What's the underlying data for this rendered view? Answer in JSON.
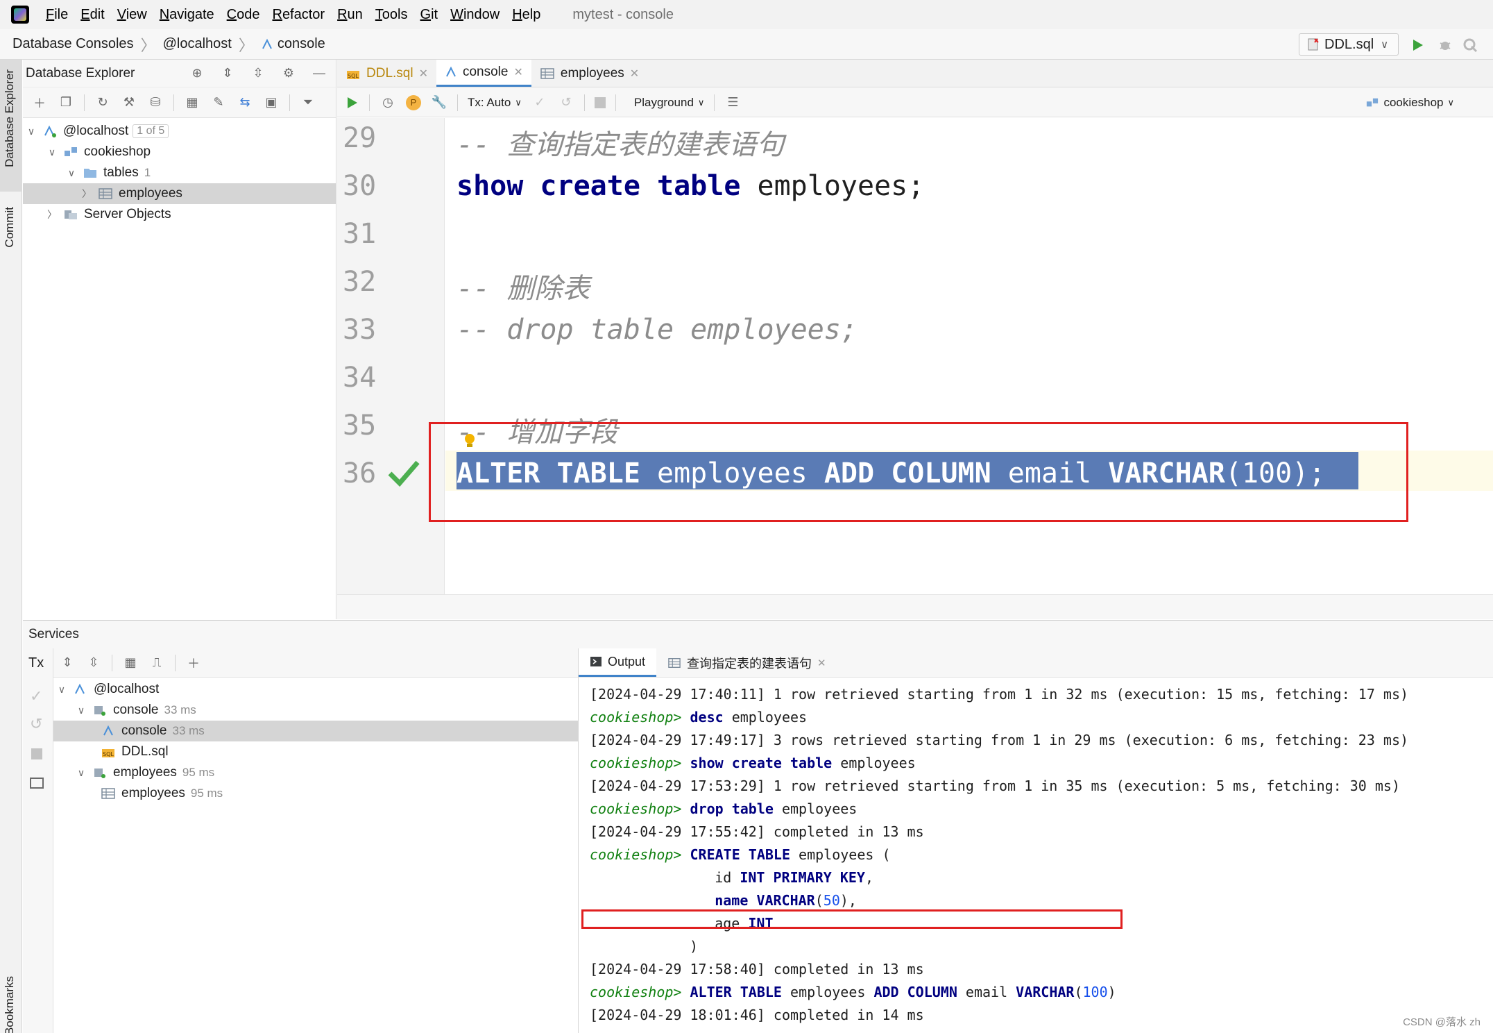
{
  "window_title": "mytest - console",
  "menu": [
    {
      "u": "F",
      "rest": "ile"
    },
    {
      "u": "E",
      "rest": "dit"
    },
    {
      "u": "V",
      "rest": "iew"
    },
    {
      "u": "N",
      "rest": "avigate"
    },
    {
      "u": "C",
      "rest": "ode"
    },
    {
      "u": "R",
      "rest": "efactor"
    },
    {
      "u": "R",
      "rest": "un"
    },
    {
      "u": "T",
      "rest": "ools"
    },
    {
      "u": "G",
      "rest": "it"
    },
    {
      "u": "W",
      "rest": "indow"
    },
    {
      "u": "H",
      "rest": "elp"
    }
  ],
  "breadcrumb": [
    "Database Consoles",
    "@localhost",
    "console"
  ],
  "run_config": "DDL.sql",
  "left_strip": {
    "database_explorer": "Database Explorer",
    "commit": "Commit",
    "bookmarks": "Bookmarks"
  },
  "db_explorer": {
    "title": "Database Explorer",
    "tree": [
      {
        "label": "@localhost",
        "badge": "1 of 5"
      },
      {
        "label": "cookieshop"
      },
      {
        "label": "tables",
        "count": "1"
      },
      {
        "label": "employees"
      },
      {
        "label": "Server Objects"
      }
    ]
  },
  "editor_tabs": [
    {
      "label": "DDL.sql",
      "icon": "sql-file-icon"
    },
    {
      "label": "console",
      "icon": "console-icon"
    },
    {
      "label": "employees",
      "icon": "table-icon"
    }
  ],
  "editor_toolbar": {
    "tx_mode": "Tx: Auto",
    "playground": "Playground",
    "schema": "cookieshop",
    "p_badge": "P"
  },
  "editor": {
    "line_numbers": [
      "29",
      "30",
      "31",
      "32",
      "33",
      "34",
      "35",
      "36"
    ],
    "line29_comment": "-- 查询指定表的建表语句",
    "line30": {
      "kw1": "show",
      "kw2": "create",
      "kw3": "table",
      "rest": " employees;"
    },
    "line32_comment": "-- 删除表",
    "line33_comment": "-- drop table employees;",
    "line35_comment": "-- 增加字段",
    "line36": {
      "kw1": "ALTER",
      "kw2": "TABLE",
      "t1": " employees ",
      "kw3": "ADD",
      "kw4": "COLUMN",
      "t2": " email ",
      "kw5": "VARCHAR",
      "paren_open": "(",
      "num": "100",
      "paren_close": ")",
      "semicolon": ";"
    }
  },
  "services": {
    "title": "Services",
    "tx_label": "Tx",
    "tree": [
      {
        "label": "@localhost"
      },
      {
        "label": "console",
        "time": "33 ms"
      },
      {
        "label": "console",
        "time": "33 ms"
      },
      {
        "label": "DDL.sql"
      },
      {
        "label": "employees",
        "time": "95 ms"
      },
      {
        "label": "employees",
        "time": "95 ms"
      }
    ],
    "output_tabs": [
      {
        "label": "Output"
      },
      {
        "label": "查询指定表的建表语句"
      }
    ],
    "prompt": "cookieshop>",
    "output": {
      "l1": "[2024-04-29 17:40:11] 1 row retrieved starting from 1 in 32 ms (execution: 15 ms, fetching: 17 ms)",
      "l2_kw": "desc",
      "l2_rest": " employees",
      "l3": "[2024-04-29 17:49:17] 3 rows retrieved starting from 1 in 29 ms (execution: 6 ms, fetching: 23 ms)",
      "l4_kw1": "show",
      "l4_kw2": "create",
      "l4_kw3": "table",
      "l4_rest": " employees",
      "l5": "[2024-04-29 17:53:29] 1 row retrieved starting from 1 in 35 ms (execution: 5 ms, fetching: 30 ms)",
      "l6_kw1": "drop",
      "l6_kw2": "table",
      "l6_rest": " employees",
      "l7": "[2024-04-29 17:55:42] completed in 13 ms",
      "l8_kw1": "CREATE",
      "l8_kw2": "TABLE",
      "l8_rest": " employees (",
      "l9_a": "     id ",
      "l9_kw1": "INT",
      "l9_kw2": "PRIMARY",
      "l9_kw3": "KEY",
      "l9_b": ",",
      "l10_a": "     ",
      "l10_kw1": "name",
      "l10_kw2": "VARCHAR",
      "l10_p1": "(",
      "l10_num": "50",
      "l10_p2": "),",
      "l11_a": "     age ",
      "l11_kw": "INT",
      "l12": ")",
      "l13": "[2024-04-29 17:58:40] completed in 13 ms",
      "l14_kw1": "ALTER",
      "l14_kw2": "TABLE",
      "l14_t1": " employees ",
      "l14_kw3": "ADD",
      "l14_kw4": "COLUMN",
      "l14_t2": " email ",
      "l14_kw5": "VARCHAR",
      "l14_p1": "(",
      "l14_num": "100",
      "l14_p2": ")",
      "l15": "[2024-04-29 18:01:46] completed in 14 ms"
    }
  },
  "watermark": "CSDN @落水 zh",
  "colors": {
    "keyword": "#000080",
    "comment": "#8c8c8c",
    "number": "#1750eb",
    "selection": "#5a7bb5",
    "highlight_box": "#e02020",
    "prompt": "#108010",
    "accent": "#4083c9"
  }
}
